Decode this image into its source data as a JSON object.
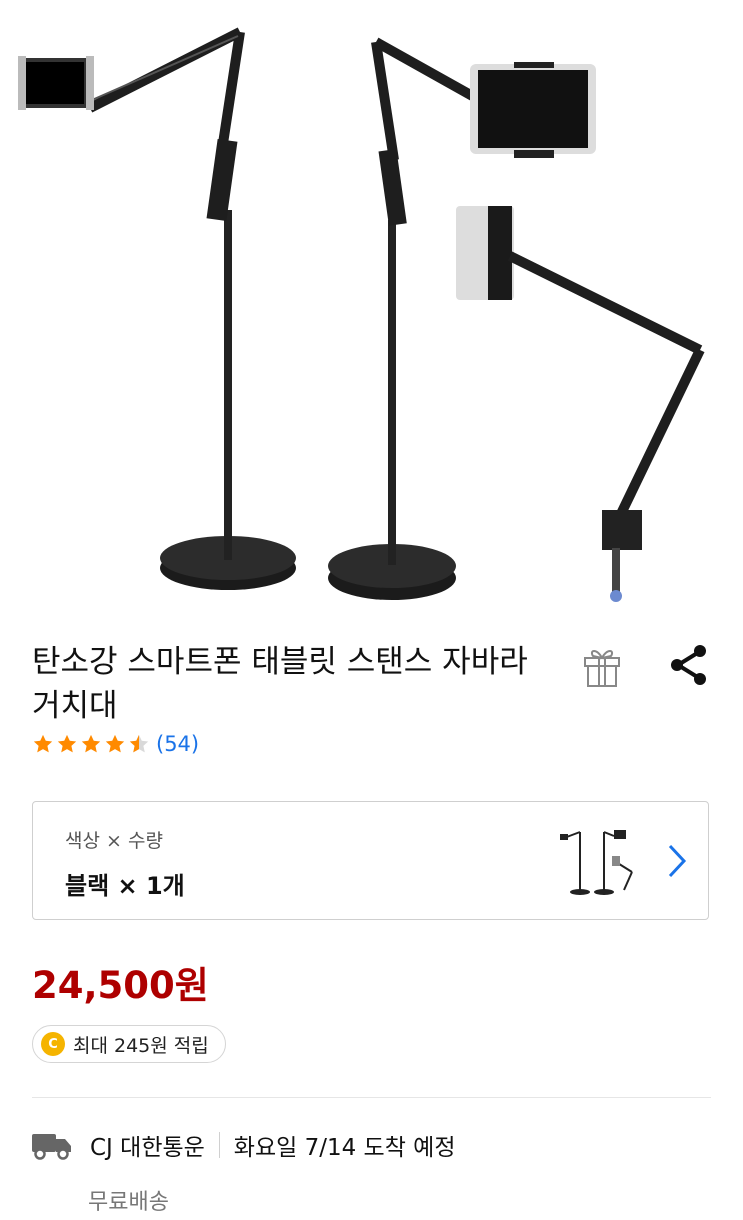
{
  "product": {
    "title": "탄소강 스마트폰 태블릿 스탠스 자바라 거치대",
    "rating_count": "(54)",
    "rating_value": 4.5,
    "rating_max": 5,
    "price": "24,500원"
  },
  "icons": {
    "gift": "gift-icon",
    "share": "share-icon",
    "chevron": "chevron-right-icon",
    "truck": "truck-icon",
    "coin": "coin-icon"
  },
  "option": {
    "label": "색상 × 수량",
    "value": "블랙 × 1개"
  },
  "reward": {
    "coin_letter": "C",
    "text": "최대 245원 적립"
  },
  "delivery": {
    "carrier": "CJ 대한통운",
    "eta": "화요일 7/14 도착 예정",
    "fee": "무료배송"
  },
  "colors": {
    "price": "#ae0000",
    "star": "#ff8a00",
    "link": "#1a73e8",
    "coin": "#f5b400"
  }
}
